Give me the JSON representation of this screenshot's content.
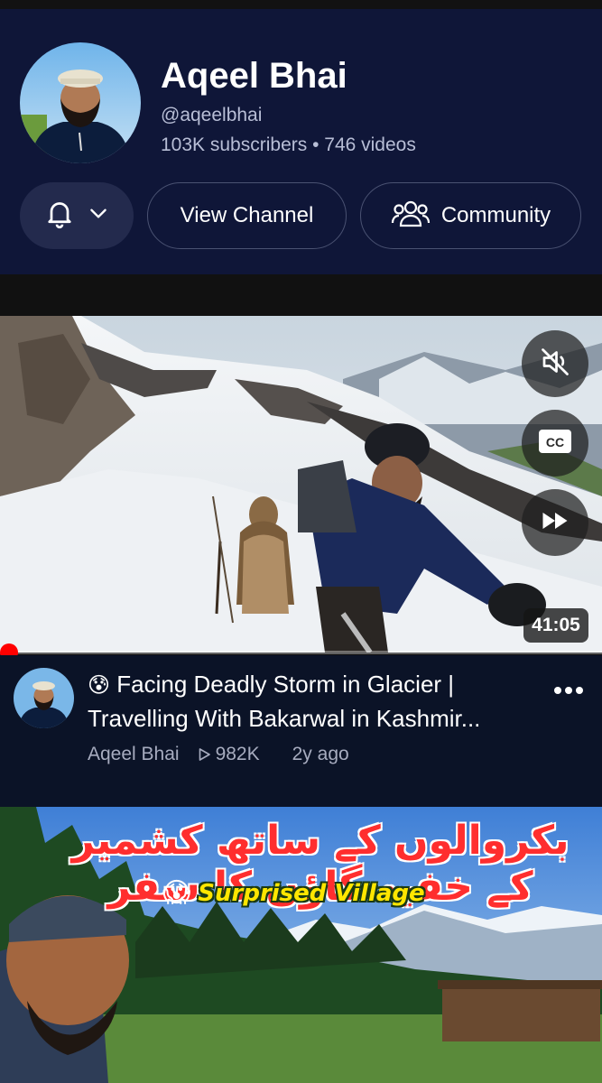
{
  "channel": {
    "name": "Aqeel Bhai",
    "handle": "@aqeelbhai",
    "stats": "103K subscribers • 746 videos",
    "buttons": {
      "view_channel": "View Channel",
      "community": "Community"
    }
  },
  "video": {
    "duration": "41:05",
    "progress_fraction": 0.0,
    "title_emoji": "😰",
    "title": "Facing Deadly Storm in Glacier | Travelling With Bakarwal in Kashmir...",
    "channel": "Aqeel Bhai",
    "views": "982K",
    "age": "2y ago",
    "controls": [
      "mute-icon",
      "captions-icon",
      "fast-forward-icon"
    ]
  },
  "next_thumbnail": {
    "urdu_title": "بکروالوں کے ساتھ کشمیر کے خفیہ گاؤں کا سفر",
    "emoji": "😱",
    "label": "Surprised Village"
  },
  "colors": {
    "card_bg": "#0f1638",
    "meta_bg": "#0b1327",
    "progress": "#ff0000"
  }
}
